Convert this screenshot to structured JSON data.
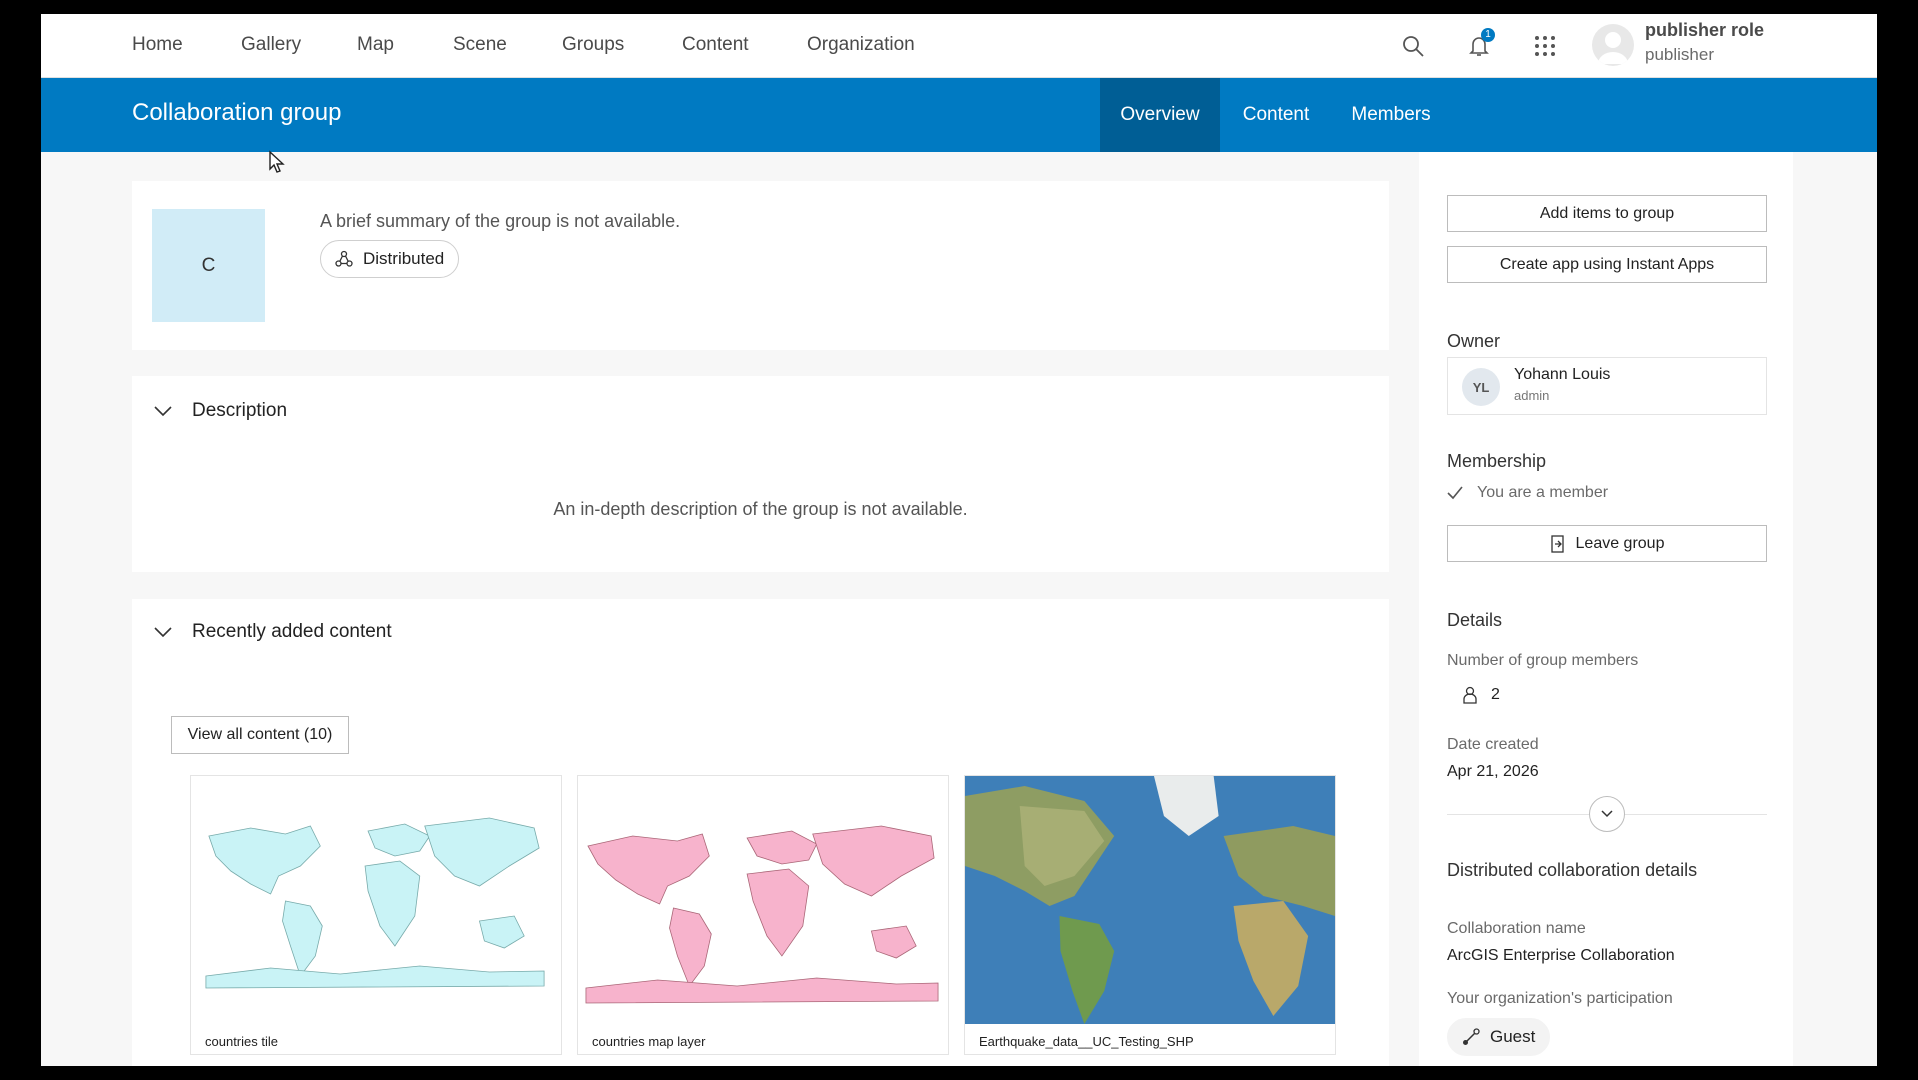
{
  "nav": {
    "items": [
      "Home",
      "Gallery",
      "Map",
      "Scene",
      "Groups",
      "Content",
      "Organization"
    ],
    "icons": [
      "search-icon",
      "bell-icon",
      "app-launcher-icon"
    ],
    "notification_count": "1",
    "user": {
      "name": "publisher role",
      "role": "publisher"
    }
  },
  "group": {
    "title": "Collaboration group",
    "tabs": [
      "Overview",
      "Content",
      "Members"
    ],
    "active_tab": "Overview",
    "thumbnail_letter": "C",
    "summary": "A brief summary of the group is not available.",
    "chip_label": "Distributed"
  },
  "description": {
    "heading": "Description",
    "text": "An in-depth description of the group is not available."
  },
  "recent": {
    "heading": "Recently added content",
    "view_all": "View all content (10)",
    "items": [
      {
        "title": "countries tile"
      },
      {
        "title": "countries map layer"
      },
      {
        "title": "Earthquake_data__UC_Testing_SHP"
      }
    ]
  },
  "sidebar": {
    "add_items": "Add items to group",
    "create_app": "Create app using Instant Apps",
    "owner_heading": "Owner",
    "owner": {
      "initials": "YL",
      "name": "Yohann Louis",
      "role": "admin"
    },
    "membership_heading": "Membership",
    "membership_status": "You are a member",
    "leave": "Leave group",
    "details_heading": "Details",
    "members_label": "Number of group members",
    "members_count": "2",
    "date_label": "Date created",
    "date_value": "Apr 21, 2026",
    "collab_heading": "Distributed collaboration details",
    "collab_name_label": "Collaboration name",
    "collab_name": "ArcGIS Enterprise Collaboration",
    "participation_label": "Your organization's participation",
    "participation": "Guest"
  },
  "colors": {
    "brand": "#007ac2",
    "brand_dark": "#005e95",
    "tile": "#d1ecf7"
  }
}
